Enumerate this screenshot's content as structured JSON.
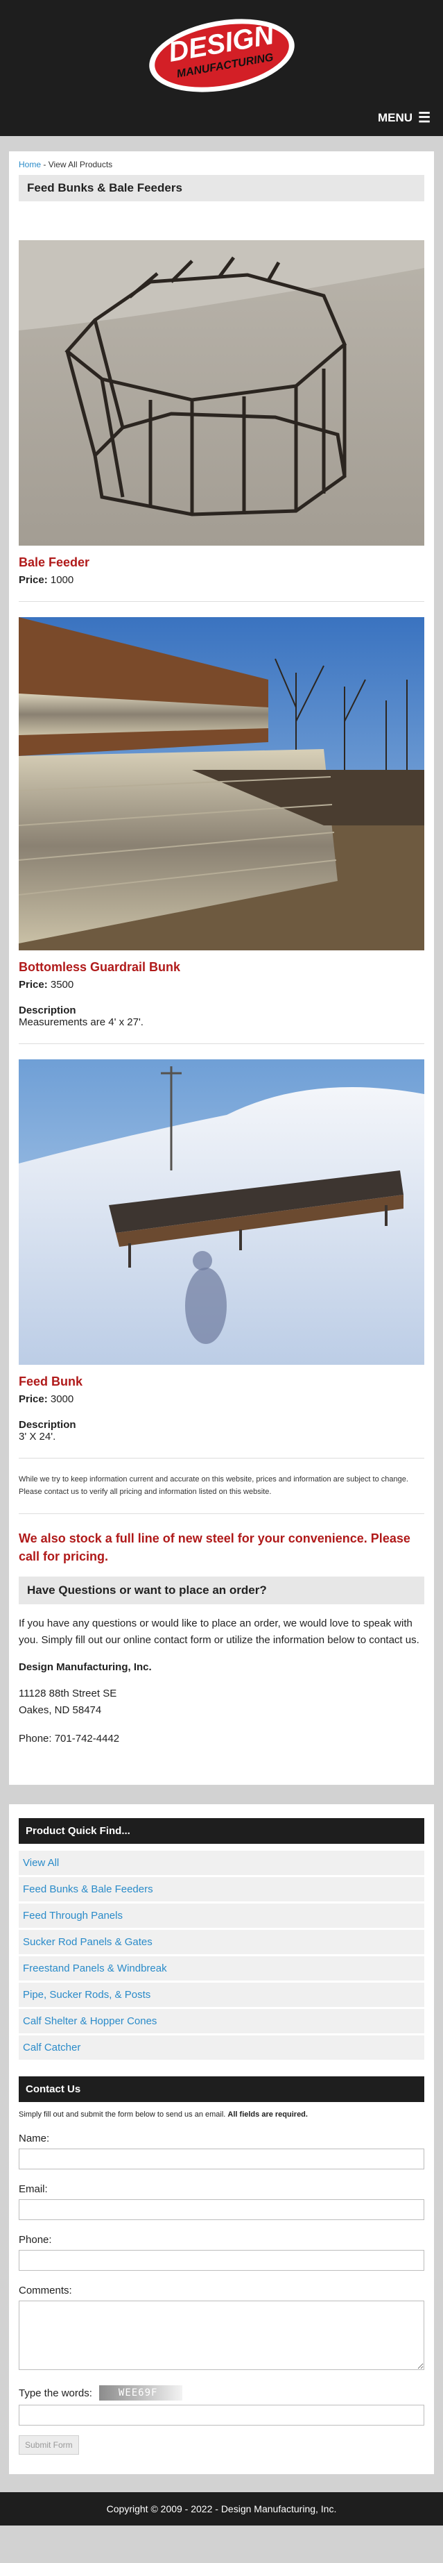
{
  "brand": {
    "line1": "DESIGN",
    "line2": "MANUFACTURING",
    "red": "#d31f26",
    "dark": "#1e1e1e"
  },
  "nav": {
    "menu_label": "MENU",
    "menu_icon": "hamburger-icon"
  },
  "breadcrumb": {
    "home": "Home",
    "sep": " - ",
    "current": "View All Products"
  },
  "page_title": "Feed Bunks & Bale Feeders",
  "products": [
    {
      "name": "Bale Feeder",
      "price_label": "Price:",
      "price": "1000",
      "image": "bale-feeder-photo"
    },
    {
      "name": "Bottomless Guardrail Bunk",
      "price_label": "Price:",
      "price": "3500",
      "desc_label": "Description",
      "desc": "Measurements are 4' x 27'.",
      "image": "guardrail-bunk-photo"
    },
    {
      "name": "Feed Bunk",
      "price_label": "Price:",
      "price": "3000",
      "desc_label": "Description",
      "desc": "3' X 24'.",
      "image": "feed-bunk-photo"
    }
  ],
  "disclaimer": "While we try to keep information current and accurate on this website, prices and information are subject to change. Please contact us to verify all pricing and information listed on this website.",
  "stock_note": "We also stock a full line of new steel for your convenience. Please call for pricing.",
  "questions": {
    "heading": "Have Questions or want to place an order?",
    "text": "If you have any questions or would like to place an order, we would love to speak with you. Simply fill out our online contact form or utilize the information below to contact us.",
    "company": "Design Manufacturing, Inc.",
    "street": "11128 88th Street SE",
    "city": "Oakes, ND 58474",
    "phone": "Phone: 701-742-4442"
  },
  "quick_find": {
    "heading": "Product Quick Find...",
    "items": [
      "View All",
      "Feed Bunks & Bale Feeders",
      "Feed Through Panels",
      "Sucker Rod Panels & Gates",
      "Freestand Panels & Windbreak",
      "Pipe, Sucker Rods, & Posts",
      "Calf Shelter & Hopper Cones",
      "Calf Catcher"
    ]
  },
  "contact_form": {
    "heading": "Contact Us",
    "note_plain": "Simply fill out and submit the form below to send us an email. ",
    "note_bold": "All fields are required.",
    "name_label": "Name:",
    "email_label": "Email:",
    "phone_label": "Phone:",
    "comments_label": "Comments:",
    "captcha_label": "Type the words:",
    "captcha_text": "WEE69F",
    "submit_label": "Submit Form"
  },
  "footer": "Copyright © 2009 - 2022 - Design Manufacturing, Inc."
}
